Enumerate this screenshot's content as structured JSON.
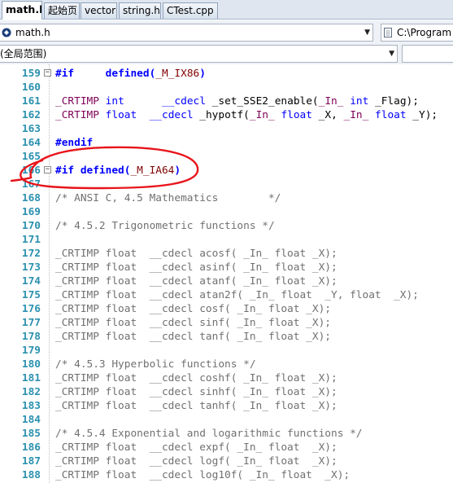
{
  "tabs": [
    {
      "label": "math.h",
      "active": true
    },
    {
      "label": "起始页",
      "active": false
    },
    {
      "label": "vector",
      "active": false
    },
    {
      "label": "string.h",
      "active": false
    },
    {
      "label": "CTest.cpp",
      "active": false
    }
  ],
  "nav": {
    "file_combo": "math.h",
    "project_combo": "C:\\Program",
    "scope_combo": "(全局范围)"
  },
  "colors": {
    "annotation_stroke": "#e8141b",
    "line_number": "#2b91af",
    "keyword": "#0000ff"
  },
  "code_lines": [
    {
      "num": "159",
      "fold": "⊟",
      "segments": [
        {
          "c": "dir",
          "t": "#if"
        },
        {
          "c": "txt",
          "t": "     "
        },
        {
          "c": "dir",
          "t": "defined("
        },
        {
          "c": "id",
          "t": "_M_IX86"
        },
        {
          "c": "dir",
          "t": ")"
        }
      ]
    },
    {
      "num": "160",
      "fold": "",
      "segments": []
    },
    {
      "num": "161",
      "fold": "",
      "segments": [
        {
          "c": "mac",
          "t": "_CRTIMP"
        },
        {
          "c": "txt",
          "t": " "
        },
        {
          "c": "typ",
          "t": "int"
        },
        {
          "c": "txt",
          "t": "      "
        },
        {
          "c": "typ",
          "t": "__cdecl"
        },
        {
          "c": "txt",
          "t": " _set_SSE2_enable("
        },
        {
          "c": "mac",
          "t": "_In_"
        },
        {
          "c": "txt",
          "t": " "
        },
        {
          "c": "typ",
          "t": "int"
        },
        {
          "c": "txt",
          "t": " _Flag);"
        }
      ]
    },
    {
      "num": "162",
      "fold": "",
      "segments": [
        {
          "c": "mac",
          "t": "_CRTIMP"
        },
        {
          "c": "txt",
          "t": " "
        },
        {
          "c": "typ",
          "t": "float"
        },
        {
          "c": "txt",
          "t": "  "
        },
        {
          "c": "typ",
          "t": "__cdecl"
        },
        {
          "c": "txt",
          "t": " _hypotf("
        },
        {
          "c": "mac",
          "t": "_In_"
        },
        {
          "c": "txt",
          "t": " "
        },
        {
          "c": "typ",
          "t": "float"
        },
        {
          "c": "txt",
          "t": " _X, "
        },
        {
          "c": "mac",
          "t": "_In_"
        },
        {
          "c": "txt",
          "t": " "
        },
        {
          "c": "typ",
          "t": "float"
        },
        {
          "c": "txt",
          "t": " _Y);"
        }
      ]
    },
    {
      "num": "163",
      "fold": "",
      "segments": []
    },
    {
      "num": "164",
      "fold": "",
      "segments": [
        {
          "c": "dir",
          "t": "#endif"
        }
      ]
    },
    {
      "num": "165",
      "fold": "",
      "segments": []
    },
    {
      "num": "166",
      "fold": "⊟",
      "segments": [
        {
          "c": "dir",
          "t": "#if defined("
        },
        {
          "c": "id",
          "t": "_M_IA64"
        },
        {
          "c": "dir",
          "t": ")"
        }
      ]
    },
    {
      "num": "167",
      "fold": "",
      "segments": []
    },
    {
      "num": "168",
      "fold": "",
      "segments": [
        {
          "c": "cmt",
          "t": "/* ANSI C, 4.5 Mathematics        */"
        }
      ]
    },
    {
      "num": "169",
      "fold": "",
      "segments": []
    },
    {
      "num": "170",
      "fold": "",
      "segments": [
        {
          "c": "cmt",
          "t": "/* 4.5.2 Trigonometric functions */"
        }
      ]
    },
    {
      "num": "171",
      "fold": "",
      "segments": []
    },
    {
      "num": "172",
      "fold": "",
      "segments": [
        {
          "c": "gray",
          "t": "_CRTIMP float  __cdecl acosf( _In_ float _X);"
        }
      ]
    },
    {
      "num": "173",
      "fold": "",
      "segments": [
        {
          "c": "gray",
          "t": "_CRTIMP float  __cdecl asinf( _In_ float _X);"
        }
      ]
    },
    {
      "num": "174",
      "fold": "",
      "segments": [
        {
          "c": "gray",
          "t": "_CRTIMP float  __cdecl atanf( _In_ float _X);"
        }
      ]
    },
    {
      "num": "175",
      "fold": "",
      "segments": [
        {
          "c": "gray",
          "t": "_CRTIMP float  __cdecl atan2f( _In_ float  _Y, float  _X);"
        }
      ]
    },
    {
      "num": "176",
      "fold": "",
      "segments": [
        {
          "c": "gray",
          "t": "_CRTIMP float  __cdecl cosf( _In_ float _X);"
        }
      ]
    },
    {
      "num": "177",
      "fold": "",
      "segments": [
        {
          "c": "gray",
          "t": "_CRTIMP float  __cdecl sinf( _In_ float _X);"
        }
      ]
    },
    {
      "num": "178",
      "fold": "",
      "segments": [
        {
          "c": "gray",
          "t": "_CRTIMP float  __cdecl tanf( _In_ float _X);"
        }
      ]
    },
    {
      "num": "179",
      "fold": "",
      "segments": []
    },
    {
      "num": "180",
      "fold": "",
      "segments": [
        {
          "c": "cmt",
          "t": "/* 4.5.3 Hyperbolic functions */"
        }
      ]
    },
    {
      "num": "181",
      "fold": "",
      "segments": [
        {
          "c": "gray",
          "t": "_CRTIMP float  __cdecl coshf( _In_ float _X);"
        }
      ]
    },
    {
      "num": "182",
      "fold": "",
      "segments": [
        {
          "c": "gray",
          "t": "_CRTIMP float  __cdecl sinhf( _In_ float _X);"
        }
      ]
    },
    {
      "num": "183",
      "fold": "",
      "segments": [
        {
          "c": "gray",
          "t": "_CRTIMP float  __cdecl tanhf( _In_ float _X);"
        }
      ]
    },
    {
      "num": "184",
      "fold": "",
      "segments": []
    },
    {
      "num": "185",
      "fold": "",
      "segments": [
        {
          "c": "cmt",
          "t": "/* 4.5.4 Exponential and logarithmic functions */"
        }
      ]
    },
    {
      "num": "186",
      "fold": "",
      "segments": [
        {
          "c": "gray",
          "t": "_CRTIMP float  __cdecl expf( _In_ float  _X);"
        }
      ]
    },
    {
      "num": "187",
      "fold": "",
      "segments": [
        {
          "c": "gray",
          "t": "_CRTIMP float  __cdecl logf( _In_ float  _X);"
        }
      ]
    },
    {
      "num": "188",
      "fold": "",
      "segments": [
        {
          "c": "gray",
          "t": "_CRTIMP float  __cdecl log10f( _In_ float  _X);"
        }
      ]
    }
  ]
}
